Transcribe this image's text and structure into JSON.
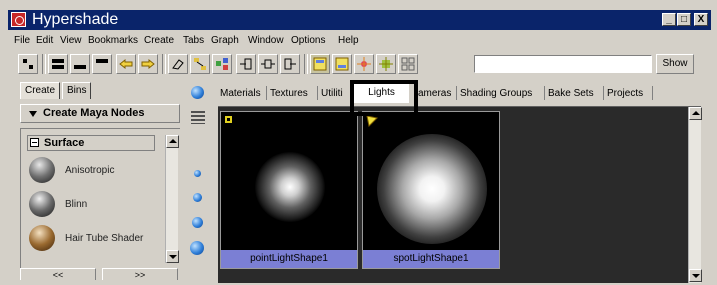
{
  "window": {
    "title": "Hypershade",
    "min_label": "_",
    "max_label": "□",
    "close_label": "X"
  },
  "menu": [
    "File",
    "Edit",
    "View",
    "Bookmarks",
    "Create",
    "Tabs",
    "Graph",
    "Window",
    "Options",
    "Help"
  ],
  "toolbar": {
    "show_label": "Show",
    "search_value": ""
  },
  "left_panel": {
    "tabs": [
      "Create",
      "Bins"
    ],
    "header": "Create Maya Nodes",
    "section": "Surface",
    "items": [
      {
        "label": "Anisotropic",
        "icon": "anisotropic-ball-icon"
      },
      {
        "label": "Blinn",
        "icon": "blinn-ball-icon"
      },
      {
        "label": "Hair Tube Shader",
        "icon": "hair-tube-ball-icon"
      }
    ],
    "nav_prev": "<<",
    "nav_next": ">>"
  },
  "right_panel": {
    "tabs": [
      "Materials",
      "Textures",
      "Utiliti",
      "Lights",
      "ameras",
      "Shading Groups",
      "Bake Sets",
      "Projects"
    ],
    "active_tab": "Lights",
    "swatches": [
      {
        "label": "pointLightShape1",
        "icon": "point-light-icon"
      },
      {
        "label": "spotLightShape1",
        "icon": "spot-light-icon"
      }
    ]
  },
  "colors": {
    "titlebar": "#0a246a",
    "swatch_caption": "#7b7fd4",
    "workspace": "#2a2a2a"
  }
}
